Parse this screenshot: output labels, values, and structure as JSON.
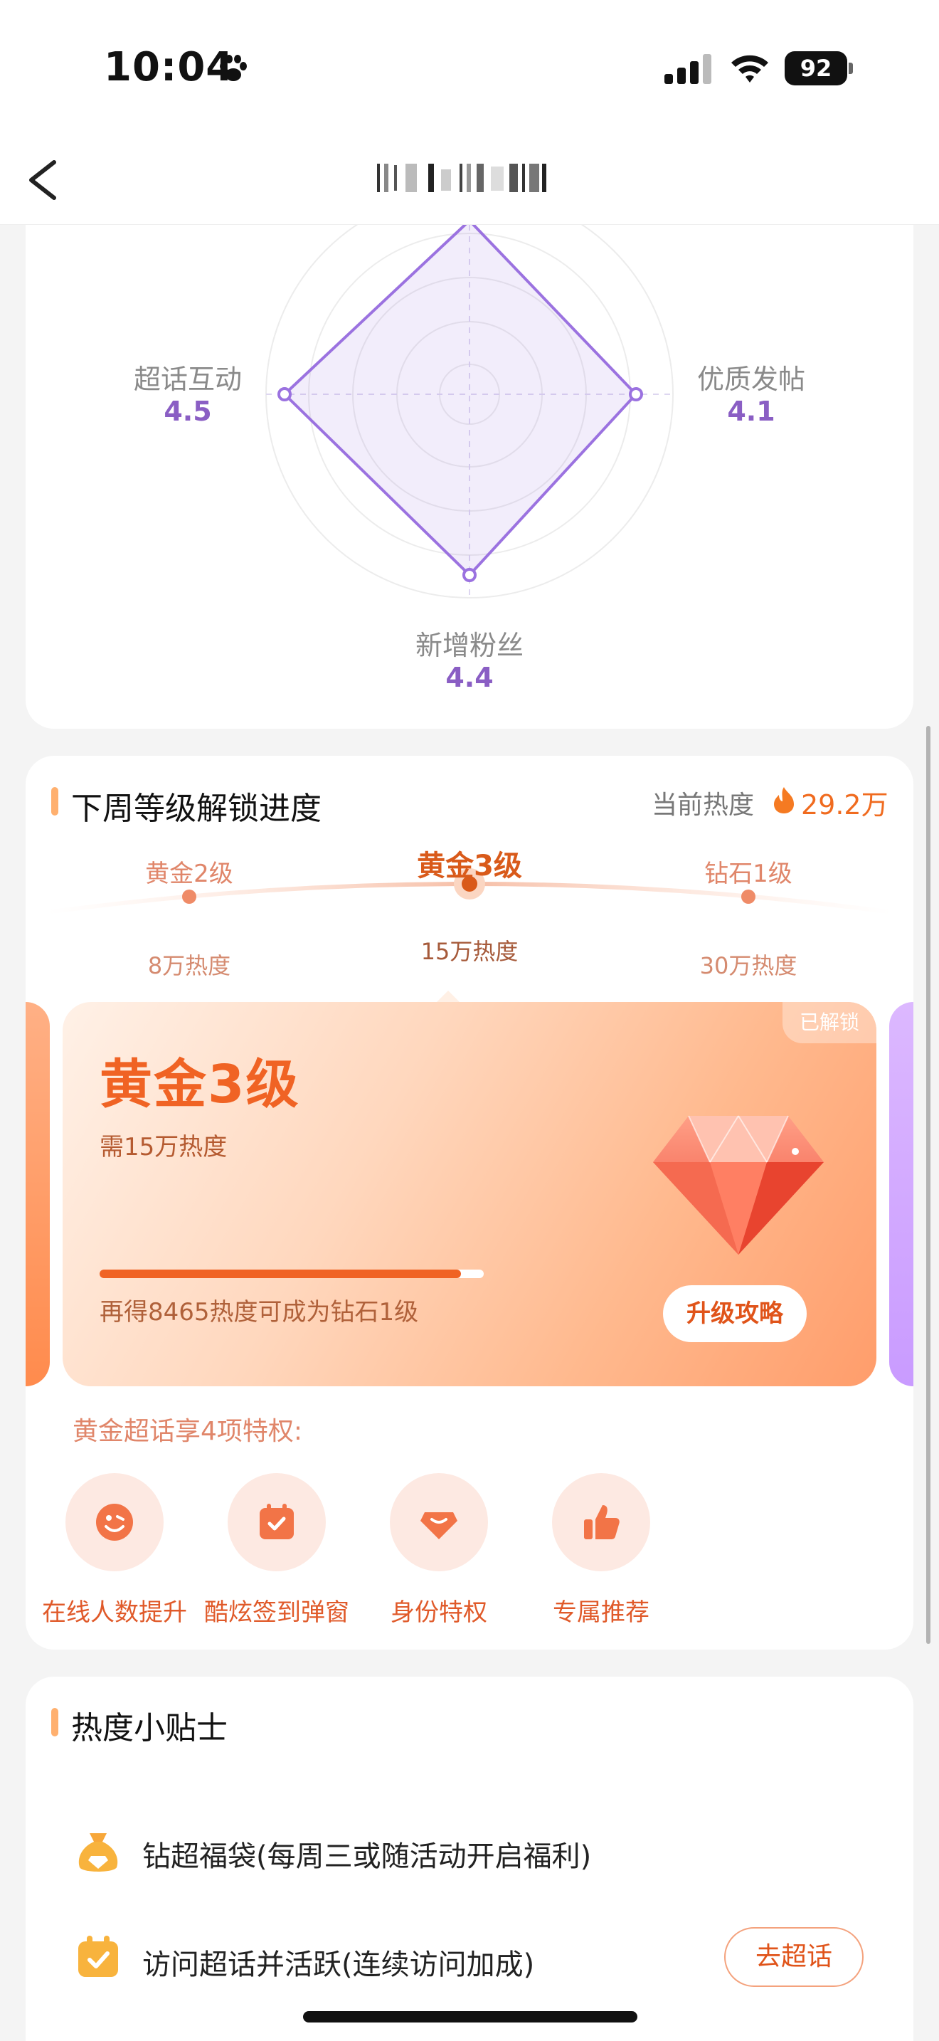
{
  "status_bar": {
    "time": "10:04",
    "battery": "92"
  },
  "nav": {
    "title": ""
  },
  "radar": {
    "axes": [
      {
        "label": "超话互动",
        "value": "4.5"
      },
      {
        "label": "优质发帖",
        "value": "4.1"
      },
      {
        "label": "新增粉丝",
        "value": "4.4"
      }
    ],
    "accent_color": "#8a5ec4"
  },
  "level_section": {
    "title": "下周等级解锁进度",
    "heat_label": "当前热度",
    "heat_value": "29.2万",
    "levels": [
      {
        "name": "黄金2级",
        "heat": "8万热度"
      },
      {
        "name": "黄金3级",
        "heat": "15万热度"
      },
      {
        "name": "钻石1级",
        "heat": "30万热度"
      }
    ],
    "panel": {
      "badge": "已解锁",
      "title": "黄金3级",
      "subtitle": "需15万热度",
      "progress": 0.94,
      "hint": "再得8465热度可成为钻石1级",
      "button": "升级攻略"
    },
    "privilege_title": "黄金超话享4项特权:",
    "privileges": [
      {
        "label": "在线人数提升",
        "icon": "smile-icon"
      },
      {
        "label": "酷炫签到弹窗",
        "icon": "calendar-check-icon"
      },
      {
        "label": "身份特权",
        "icon": "diamond-badge-icon"
      },
      {
        "label": "专属推荐",
        "icon": "thumbs-up-icon"
      }
    ]
  },
  "tips": {
    "title": "热度小贴士",
    "items": [
      {
        "text": "钻超福袋(每周三或随活动开启福利)",
        "icon": "lucky-bag-icon"
      },
      {
        "text": "访问超话并活跃(连续访问加成)",
        "icon": "calendar-check-icon",
        "button": "去超话"
      }
    ]
  },
  "colors": {
    "brand_orange": "#f06324",
    "radar_purple": "#8a5ec4"
  }
}
